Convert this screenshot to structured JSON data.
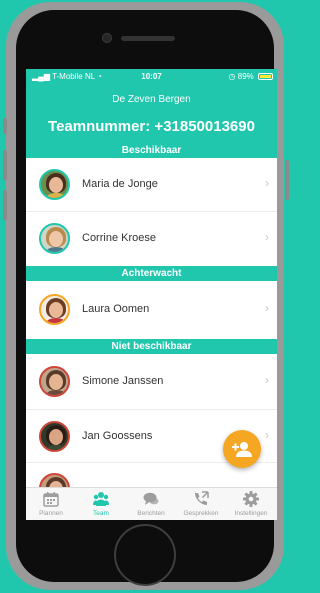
{
  "status": {
    "carrier": "T-Mobile NL",
    "time": "10:07",
    "battery": "89%"
  },
  "header": {
    "subtitle": "De Zeven Bergen",
    "team_number": "Teamnummer: +31850013690"
  },
  "sections": [
    {
      "title": "Beschikbaar",
      "members": [
        {
          "name": "Maria de Jonge"
        },
        {
          "name": "Corrine Kroese"
        }
      ]
    },
    {
      "title": "Achterwacht",
      "members": [
        {
          "name": "Laura Oomen"
        }
      ]
    },
    {
      "title": "Niet beschikbaar",
      "members": [
        {
          "name": "Simone Janssen"
        },
        {
          "name": "Jan Goossens"
        }
      ]
    }
  ],
  "tabs": [
    {
      "label": "Plannen",
      "icon": "calendar-icon"
    },
    {
      "label": "Team",
      "icon": "team-icon",
      "active": true
    },
    {
      "label": "Berichten",
      "icon": "chat-icon"
    },
    {
      "label": "Gesprekken",
      "icon": "phone-call-icon"
    },
    {
      "label": "Instellingen",
      "icon": "gear-icon"
    }
  ],
  "colors": {
    "brand": "#21c7ad",
    "available_ring": "#21c7ad",
    "backup_ring": "#f5a623",
    "unavailable_ring": "#d0453a",
    "fab": "#f5a623"
  }
}
